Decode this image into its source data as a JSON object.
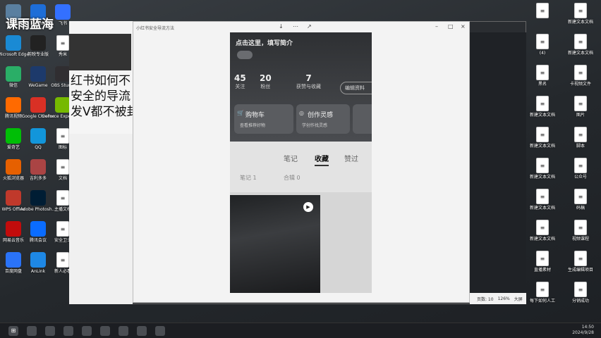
{
  "watermark": "课雨蓝海",
  "overlay_text": [
    "红书如何不",
    "安全的导流",
    "发V都不被封"
  ],
  "left_icons": [
    {
      "label": "回收站",
      "icon": "recycle-bin-icon",
      "color": "#5a7fa0"
    },
    {
      "label": "ToDesk",
      "icon": "todesk-icon",
      "color": "#1e6ed8"
    },
    {
      "label": "飞书",
      "icon": "feishu-icon",
      "color": "#3370ff"
    },
    {
      "label": "Microsoft Edge",
      "icon": "edge-icon",
      "color": "#1a8ad4"
    },
    {
      "label": "剪映专业版",
      "icon": "jianying-icon",
      "color": "#222"
    },
    {
      "label": "秀米",
      "icon": "document-icon",
      "color": "#fff"
    },
    {
      "label": "微信",
      "icon": "wechat-icon",
      "color": "#2aae67"
    },
    {
      "label": "WeGame",
      "icon": "wegame-icon",
      "color": "#1d3a6b"
    },
    {
      "label": "OBS Studio",
      "icon": "obs-icon",
      "color": "#302e31"
    },
    {
      "label": "腾讯视频",
      "icon": "tencent-video-icon",
      "color": "#ff6a00"
    },
    {
      "label": "Google Chrome",
      "icon": "chrome-icon",
      "color": "#d93025"
    },
    {
      "label": "GeForce Experience",
      "icon": "geforce-icon",
      "color": "#76b900"
    },
    {
      "label": "爱奇艺",
      "icon": "iqiyi-icon",
      "color": "#00be06"
    },
    {
      "label": "QQ",
      "icon": "qq-icon",
      "color": "#1296db"
    },
    {
      "label": "图标",
      "icon": "document-icon",
      "color": "#fff"
    },
    {
      "label": "火狐浏览器",
      "icon": "firefox-icon",
      "color": "#e66000"
    },
    {
      "label": "吉利多多",
      "icon": "app-icon",
      "color": "#aa4444"
    },
    {
      "label": "文档",
      "icon": "document-icon",
      "color": "#fff"
    },
    {
      "label": "WPS Office",
      "icon": "wps-icon",
      "color": "#c0392b"
    },
    {
      "label": "Adobe Photosh...",
      "icon": "photoshop-icon",
      "color": "#001d34"
    },
    {
      "label": "主播文档",
      "icon": "document-icon",
      "color": "#fff"
    },
    {
      "label": "网易云音乐",
      "icon": "netease-music-icon",
      "color": "#c20c0c"
    },
    {
      "label": "腾讯会议",
      "icon": "tencent-meeting-icon",
      "color": "#0a6cff"
    },
    {
      "label": "安全卫士",
      "icon": "document-icon",
      "color": "#fff"
    },
    {
      "label": "百度网盘",
      "icon": "baidu-netdisk-icon",
      "color": "#2a73f8"
    },
    {
      "label": "AnLink",
      "icon": "anlink-icon",
      "color": "#1e88e5"
    },
    {
      "label": "新人必看",
      "icon": "document-icon",
      "color": "#fff"
    }
  ],
  "right_icons": [
    {
      "label": "",
      "icon": "document-icon"
    },
    {
      "label": "新建文本文档",
      "icon": "document-icon"
    },
    {
      "label": "(4)",
      "icon": "document-icon"
    },
    {
      "label": "新建文本文档",
      "icon": "document-icon"
    },
    {
      "label": "黑名",
      "icon": "document-icon"
    },
    {
      "label": "卡视频文件",
      "icon": "document-icon"
    },
    {
      "label": "新建文本文档",
      "icon": "document-icon"
    },
    {
      "label": "图片",
      "icon": "document-icon"
    },
    {
      "label": "新建文本文档",
      "icon": "document-icon"
    },
    {
      "label": "脚本",
      "icon": "document-icon"
    },
    {
      "label": "新建文本文档",
      "icon": "document-icon"
    },
    {
      "label": "公众号",
      "icon": "document-icon"
    },
    {
      "label": "新建文本文档",
      "icon": "document-icon"
    },
    {
      "label": "码稿",
      "icon": "document-icon"
    },
    {
      "label": "新建文本文档",
      "icon": "document-icon"
    },
    {
      "label": "视频课程",
      "icon": "document-icon"
    },
    {
      "label": "直播素材",
      "icon": "document-icon"
    },
    {
      "label": "生成编辑项目",
      "icon": "document-icon"
    },
    {
      "label": "每下如何人工",
      "icon": "document-icon"
    },
    {
      "label": "分销成功",
      "icon": "document-icon"
    }
  ],
  "viewer": {
    "title": "小红书安全导流方法",
    "menu_glyphs": [
      "↓",
      "⋯",
      "↗"
    ],
    "status": [
      "页数: 10",
      "126%",
      "大屏"
    ]
  },
  "phone": {
    "header_label": "点击这里，填写简介",
    "stats": [
      {
        "num": "45",
        "cap": "关注"
      },
      {
        "num": "20",
        "cap": "粉丝"
      },
      {
        "num": "7",
        "cap": "获赞与收藏"
      }
    ],
    "edit_label": "编辑资料",
    "cards": [
      {
        "title": "购物车",
        "sub": "查看推荐好物"
      },
      {
        "title": "创作灵感",
        "sub": "学创作找灵感"
      },
      {
        "title": "",
        "sub": ""
      }
    ],
    "tabs": [
      "笔记",
      "收藏",
      "赞过"
    ],
    "active_tab": "收藏",
    "subtabs": [
      "笔记 1",
      "合辑 0"
    ]
  },
  "taskbar": {
    "time": "14:50",
    "date": "2024/9/28",
    "icons": [
      "windows-icon",
      "search-icon",
      "edge-icon",
      "explorer-icon",
      "wechat-icon",
      "qq-icon",
      "app-icon",
      "photo-icon",
      "chrome-icon"
    ]
  }
}
